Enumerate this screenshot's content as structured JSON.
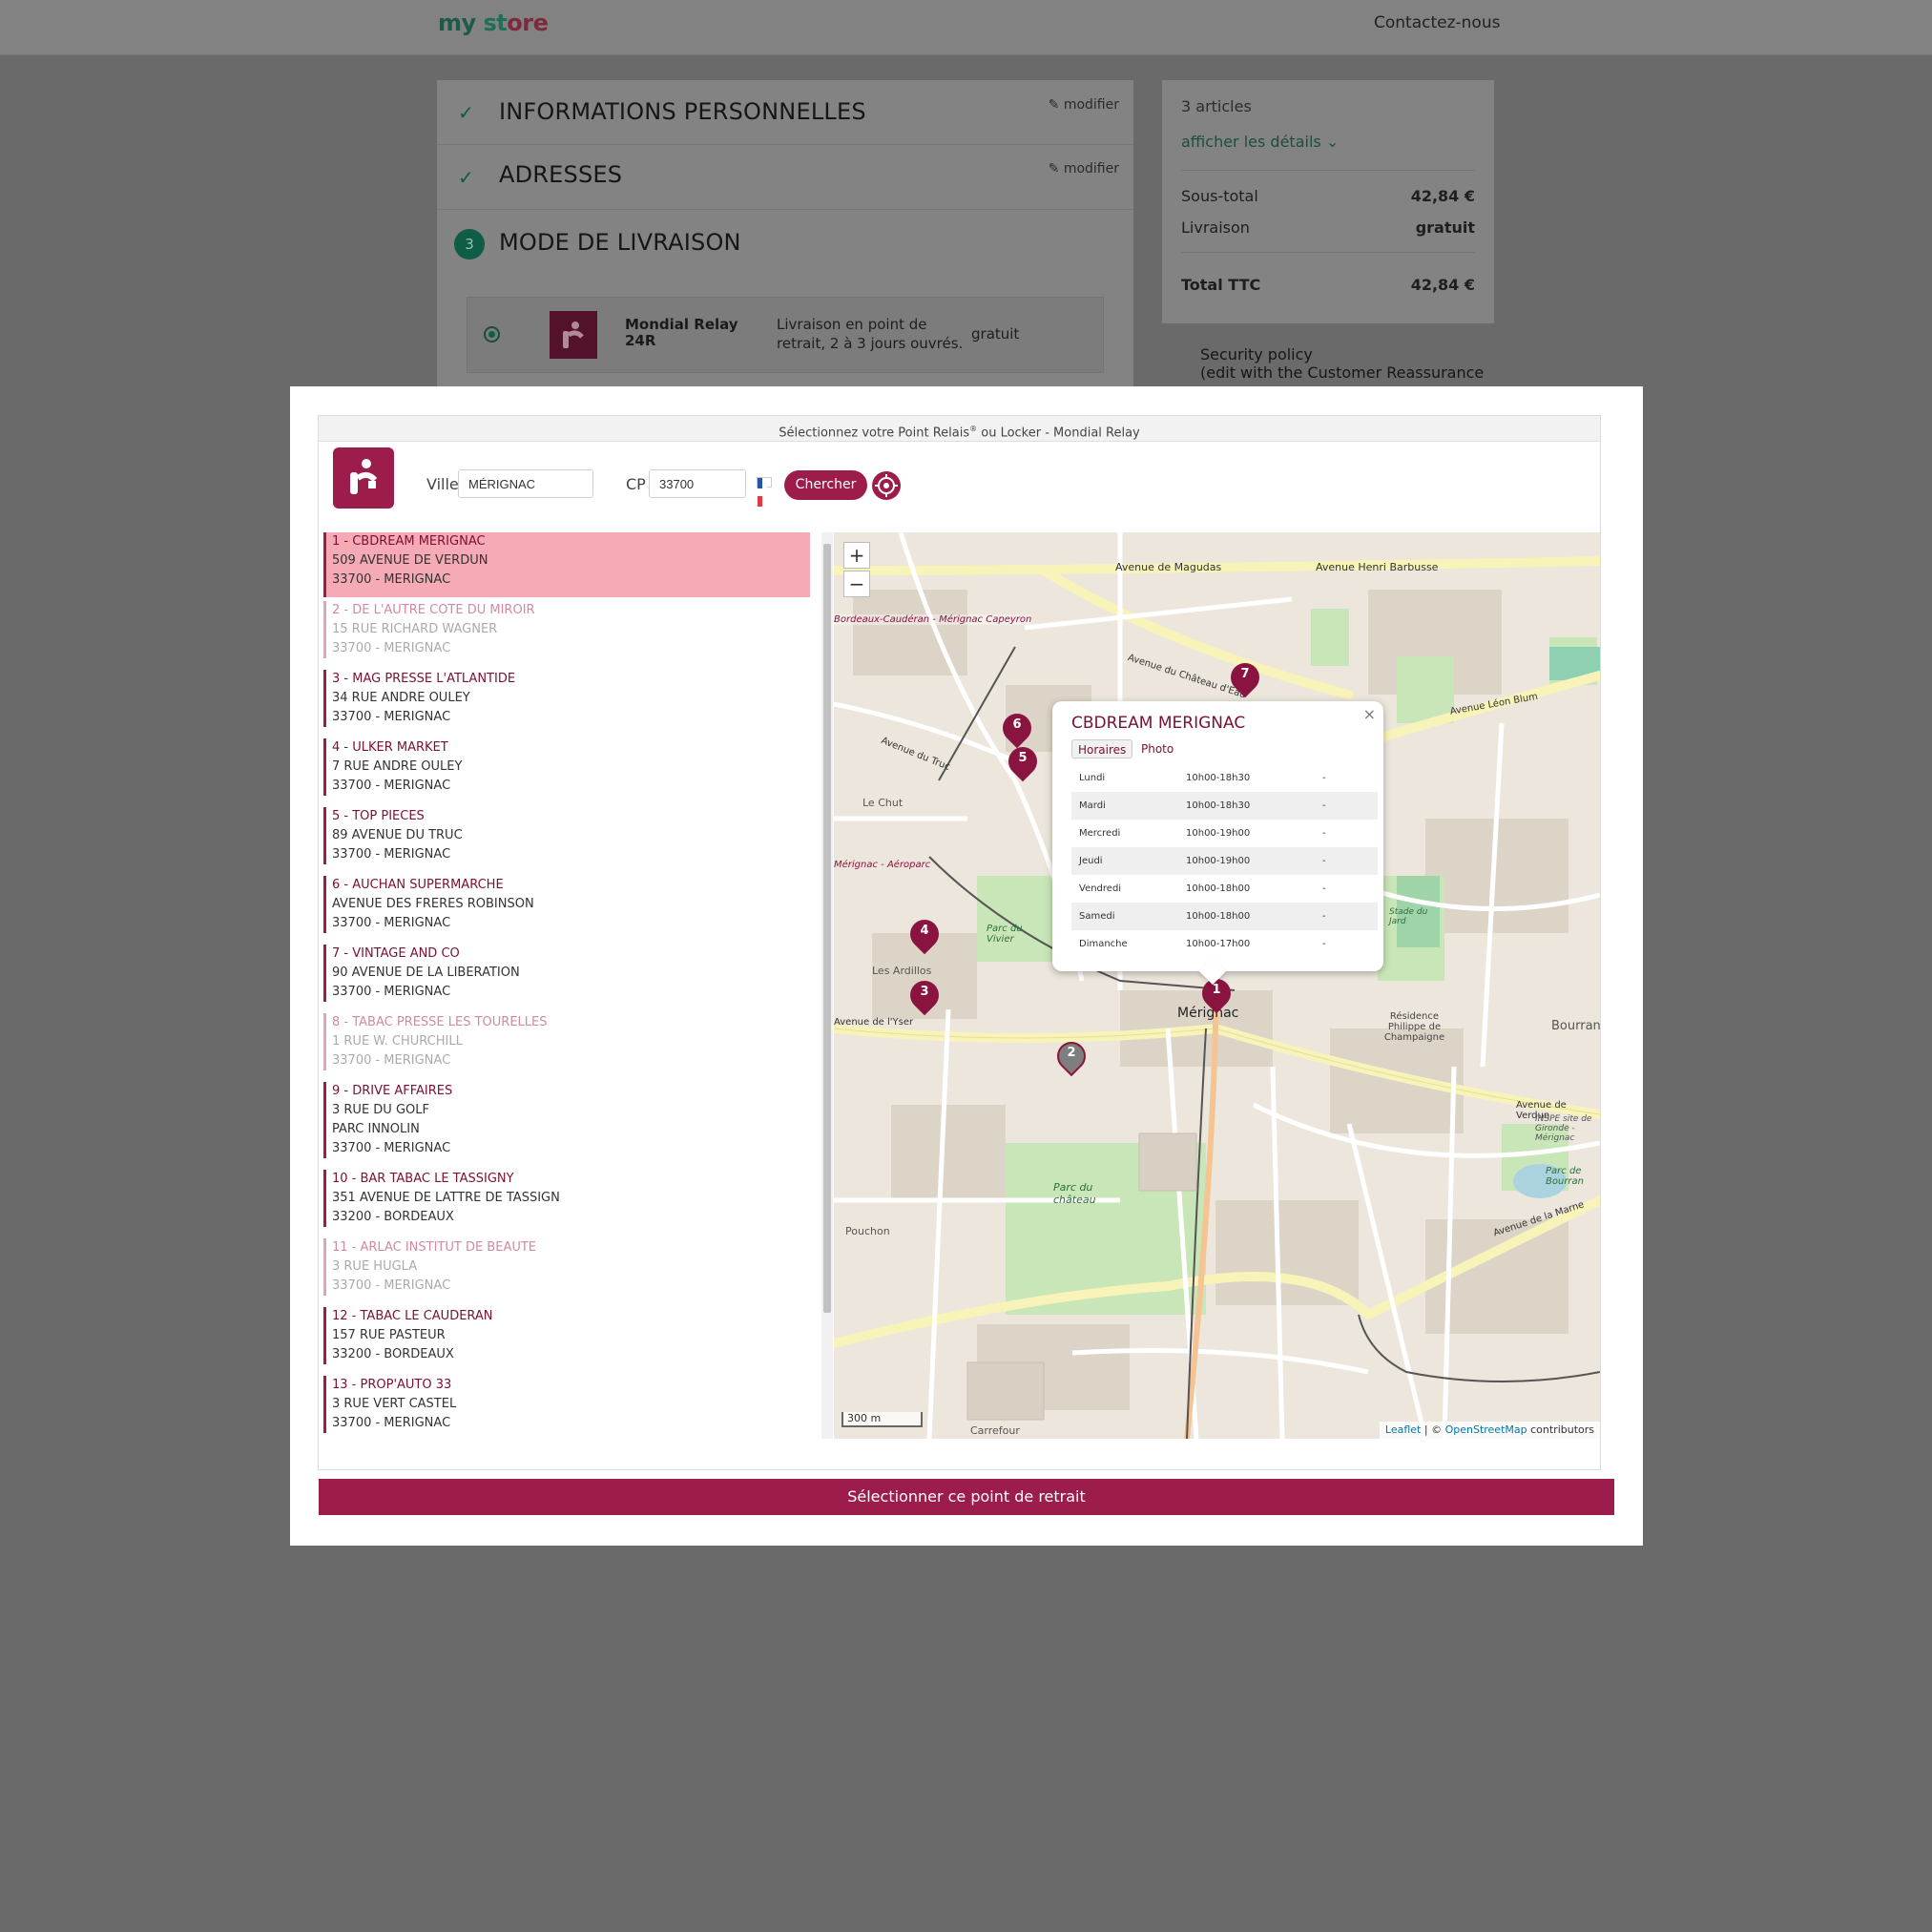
{
  "header": {
    "logo_part1": "my",
    "logo_part2": "st",
    "logo_part3": "ore",
    "contact": "Contactez-nous"
  },
  "steps": {
    "personal": {
      "title": "INFORMATIONS PERSONNELLES",
      "modify": "modifier"
    },
    "addresses": {
      "title": "ADRESSES",
      "modify": "modifier"
    },
    "delivery": {
      "number": "3",
      "title": "MODE DE LIVRAISON"
    }
  },
  "carrier": {
    "name": "Mondial Relay 24R",
    "description": "Livraison en point de retrait, 2 à 3 jours ouvrés.",
    "price": "gratuit"
  },
  "summary": {
    "count": "3 articles",
    "details_link": "afficher les détails",
    "subtotal_label": "Sous-total",
    "subtotal_value": "42,84 €",
    "shipping_label": "Livraison",
    "shipping_value": "gratuit",
    "total_label": "Total TTC",
    "total_value": "42,84 €"
  },
  "security": {
    "line1": "Security policy",
    "line2": "(edit with the Customer Reassurance"
  },
  "widget": {
    "title_a": "Sélectionnez votre Point Relais",
    "title_reg": "®",
    "title_b": " ou Locker - Mondial Relay",
    "city_label": "Ville",
    "city_value": "MÉRIGNAC",
    "cp_label": "CP",
    "cp_value": "33700",
    "search_button": "Chercher"
  },
  "points": [
    {
      "name": "1 - CBDREAM MERIGNAC",
      "lines": [
        "509 AVENUE DE VERDUN",
        "33700 - MERIGNAC"
      ]
    },
    {
      "name": "2 - DE L'AUTRE COTE DU MIROIR",
      "lines": [
        "15 RUE RICHARD WAGNER",
        "33700 - MERIGNAC"
      ]
    },
    {
      "name": "3 - MAG PRESSE L'ATLANTIDE",
      "lines": [
        "34 RUE ANDRE OULEY",
        "33700 - MERIGNAC"
      ]
    },
    {
      "name": "4 - ULKER MARKET",
      "lines": [
        "7 RUE ANDRE OULEY",
        "33700 - MERIGNAC"
      ]
    },
    {
      "name": "5 - TOP PIECES",
      "lines": [
        "89 AVENUE DU TRUC",
        "33700 - MERIGNAC"
      ]
    },
    {
      "name": "6 - AUCHAN SUPERMARCHE",
      "lines": [
        "AVENUE DES FRERES ROBINSON",
        "33700 - MERIGNAC"
      ]
    },
    {
      "name": "7 - VINTAGE AND CO",
      "lines": [
        "90 AVENUE DE LA LIBERATION",
        "33700 - MERIGNAC"
      ]
    },
    {
      "name": "8 - TABAC PRESSE LES TOURELLES",
      "lines": [
        "1 RUE W. CHURCHILL",
        "33700 - MERIGNAC"
      ]
    },
    {
      "name": "9 - DRIVE AFFAIRES",
      "lines": [
        "3 RUE DU GOLF",
        "PARC INNOLIN",
        "33700 - MERIGNAC"
      ]
    },
    {
      "name": "10 - BAR TABAC LE TASSIGNY",
      "lines": [
        "351 AVENUE DE LATTRE DE TASSIGN",
        "33200 - BORDEAUX"
      ]
    },
    {
      "name": "11 - ARLAC INSTITUT DE BEAUTE",
      "lines": [
        "3 RUE HUGLA",
        "33700 - MERIGNAC"
      ]
    },
    {
      "name": "12 - TABAC LE CAUDERAN",
      "lines": [
        "157 RUE PASTEUR",
        "33200 - BORDEAUX"
      ]
    },
    {
      "name": "13 - PROP'AUTO 33",
      "lines": [
        "3 RUE VERT CASTEL",
        "33700 - MERIGNAC"
      ]
    }
  ],
  "map": {
    "zoom_in": "+",
    "zoom_out": "−",
    "scale": "300 m",
    "attribution_leaflet": "Leaflet",
    "attribution_sep": " | © ",
    "attribution_osm": "OpenStreetMap",
    "attribution_tail": " contributors",
    "labels": {
      "magudas": "Avenue de Magudas",
      "barbusse": "Avenue Henri Barbusse",
      "chateau": "Avenue du Château d'Eau",
      "leonblum": "Avenue Léon Blum",
      "truc": "Avenue du Truc",
      "verdun": "Avenue de Verdun",
      "yser": "Avenue de l'Yser",
      "marne": "Avenue de la Marne",
      "capeyron": "Bordeaux-Caudéran - Mérignac Capeyron",
      "aeroparc": "Mérignac - Aéroparc",
      "merignac": "Mérignac",
      "bourran": "Bourran",
      "parcvivier": "Parc du Vivier",
      "parcchateau": "Parc du château",
      "ardillos": "Les Ardillos",
      "lechut": "Le Chut",
      "pouchon": "Pouchon",
      "carrefour": "Carrefour",
      "residence": "Résidence Philippe de Champaigne",
      "stade": "Stade du Jard",
      "inspe": "INSPE site de Gironde - Mérignac",
      "parcbourran": "Parc de Bourran"
    },
    "markers": [
      "1",
      "2",
      "3",
      "4",
      "5",
      "6",
      "7"
    ]
  },
  "popup": {
    "title": "CBDREAM MERIGNAC",
    "tab_hours": "Horaires",
    "tab_photo": "Photo",
    "close": "×",
    "hours": [
      {
        "day": "Lundi",
        "hours": "10h00-18h30",
        "extra": "-"
      },
      {
        "day": "Mardi",
        "hours": "10h00-18h30",
        "extra": "-"
      },
      {
        "day": "Mercredi",
        "hours": "10h00-19h00",
        "extra": "-"
      },
      {
        "day": "Jeudi",
        "hours": "10h00-19h00",
        "extra": "-"
      },
      {
        "day": "Vendredi",
        "hours": "10h00-18h00",
        "extra": "-"
      },
      {
        "day": "Samedi",
        "hours": "10h00-18h00",
        "extra": "-"
      },
      {
        "day": "Dimanche",
        "hours": "10h00-17h00",
        "extra": "-"
      }
    ]
  },
  "select_button": "Sélectionner ce point de retrait",
  "colors": {
    "brand": "#9c1c4b",
    "brand_dark": "#7a1035",
    "selected_bg": "#f5aab5",
    "overlay": "#6a6a6a"
  }
}
